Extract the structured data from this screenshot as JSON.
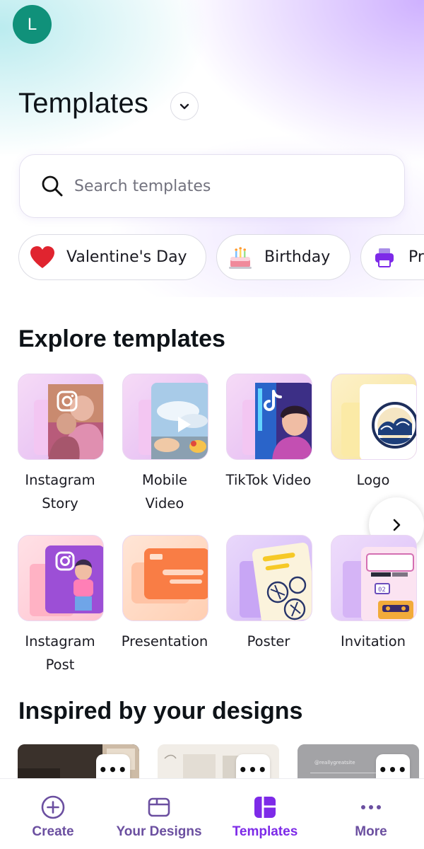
{
  "user": {
    "avatar_initial": "L"
  },
  "header": {
    "title": "Templates"
  },
  "search": {
    "placeholder": "Search templates"
  },
  "chips": [
    {
      "label": "Valentine's Day",
      "icon": "heart-icon"
    },
    {
      "label": "Birthday",
      "icon": "birthday-cake-icon"
    },
    {
      "label": "Pr",
      "icon": "printer-icon"
    }
  ],
  "explore": {
    "title": "Explore templates",
    "items": [
      {
        "label_line1": "Instagram",
        "label_line2": "Story"
      },
      {
        "label_line1": "Mobile",
        "label_line2": "Video"
      },
      {
        "label_line1": "TikTok Video",
        "label_line2": ""
      },
      {
        "label_line1": "Logo",
        "label_line2": ""
      },
      {
        "label_line1": "Instagram",
        "label_line2": "Post"
      },
      {
        "label_line1": "Presentation",
        "label_line2": ""
      },
      {
        "label_line1": "Poster",
        "label_line2": ""
      },
      {
        "label_line1": "Invitation",
        "label_line2": ""
      }
    ]
  },
  "inspired": {
    "title": "Inspired by your designs",
    "cards": [
      {
        "more": "•••"
      },
      {
        "more": "•••"
      },
      {
        "caption": "@reallygreatsite",
        "more": "•••"
      }
    ]
  },
  "bottom_nav": {
    "items": [
      {
        "label": "Create",
        "icon": "plus-circle-icon"
      },
      {
        "label": "Your Designs",
        "icon": "folder-icon"
      },
      {
        "label": "Templates",
        "icon": "templates-grid-icon",
        "active": true
      },
      {
        "label": "More",
        "icon": "more-dots-icon"
      }
    ]
  },
  "colors": {
    "accent": "#7d2ae8",
    "nav_text": "#6b4fa0",
    "avatar": "#10917a"
  }
}
